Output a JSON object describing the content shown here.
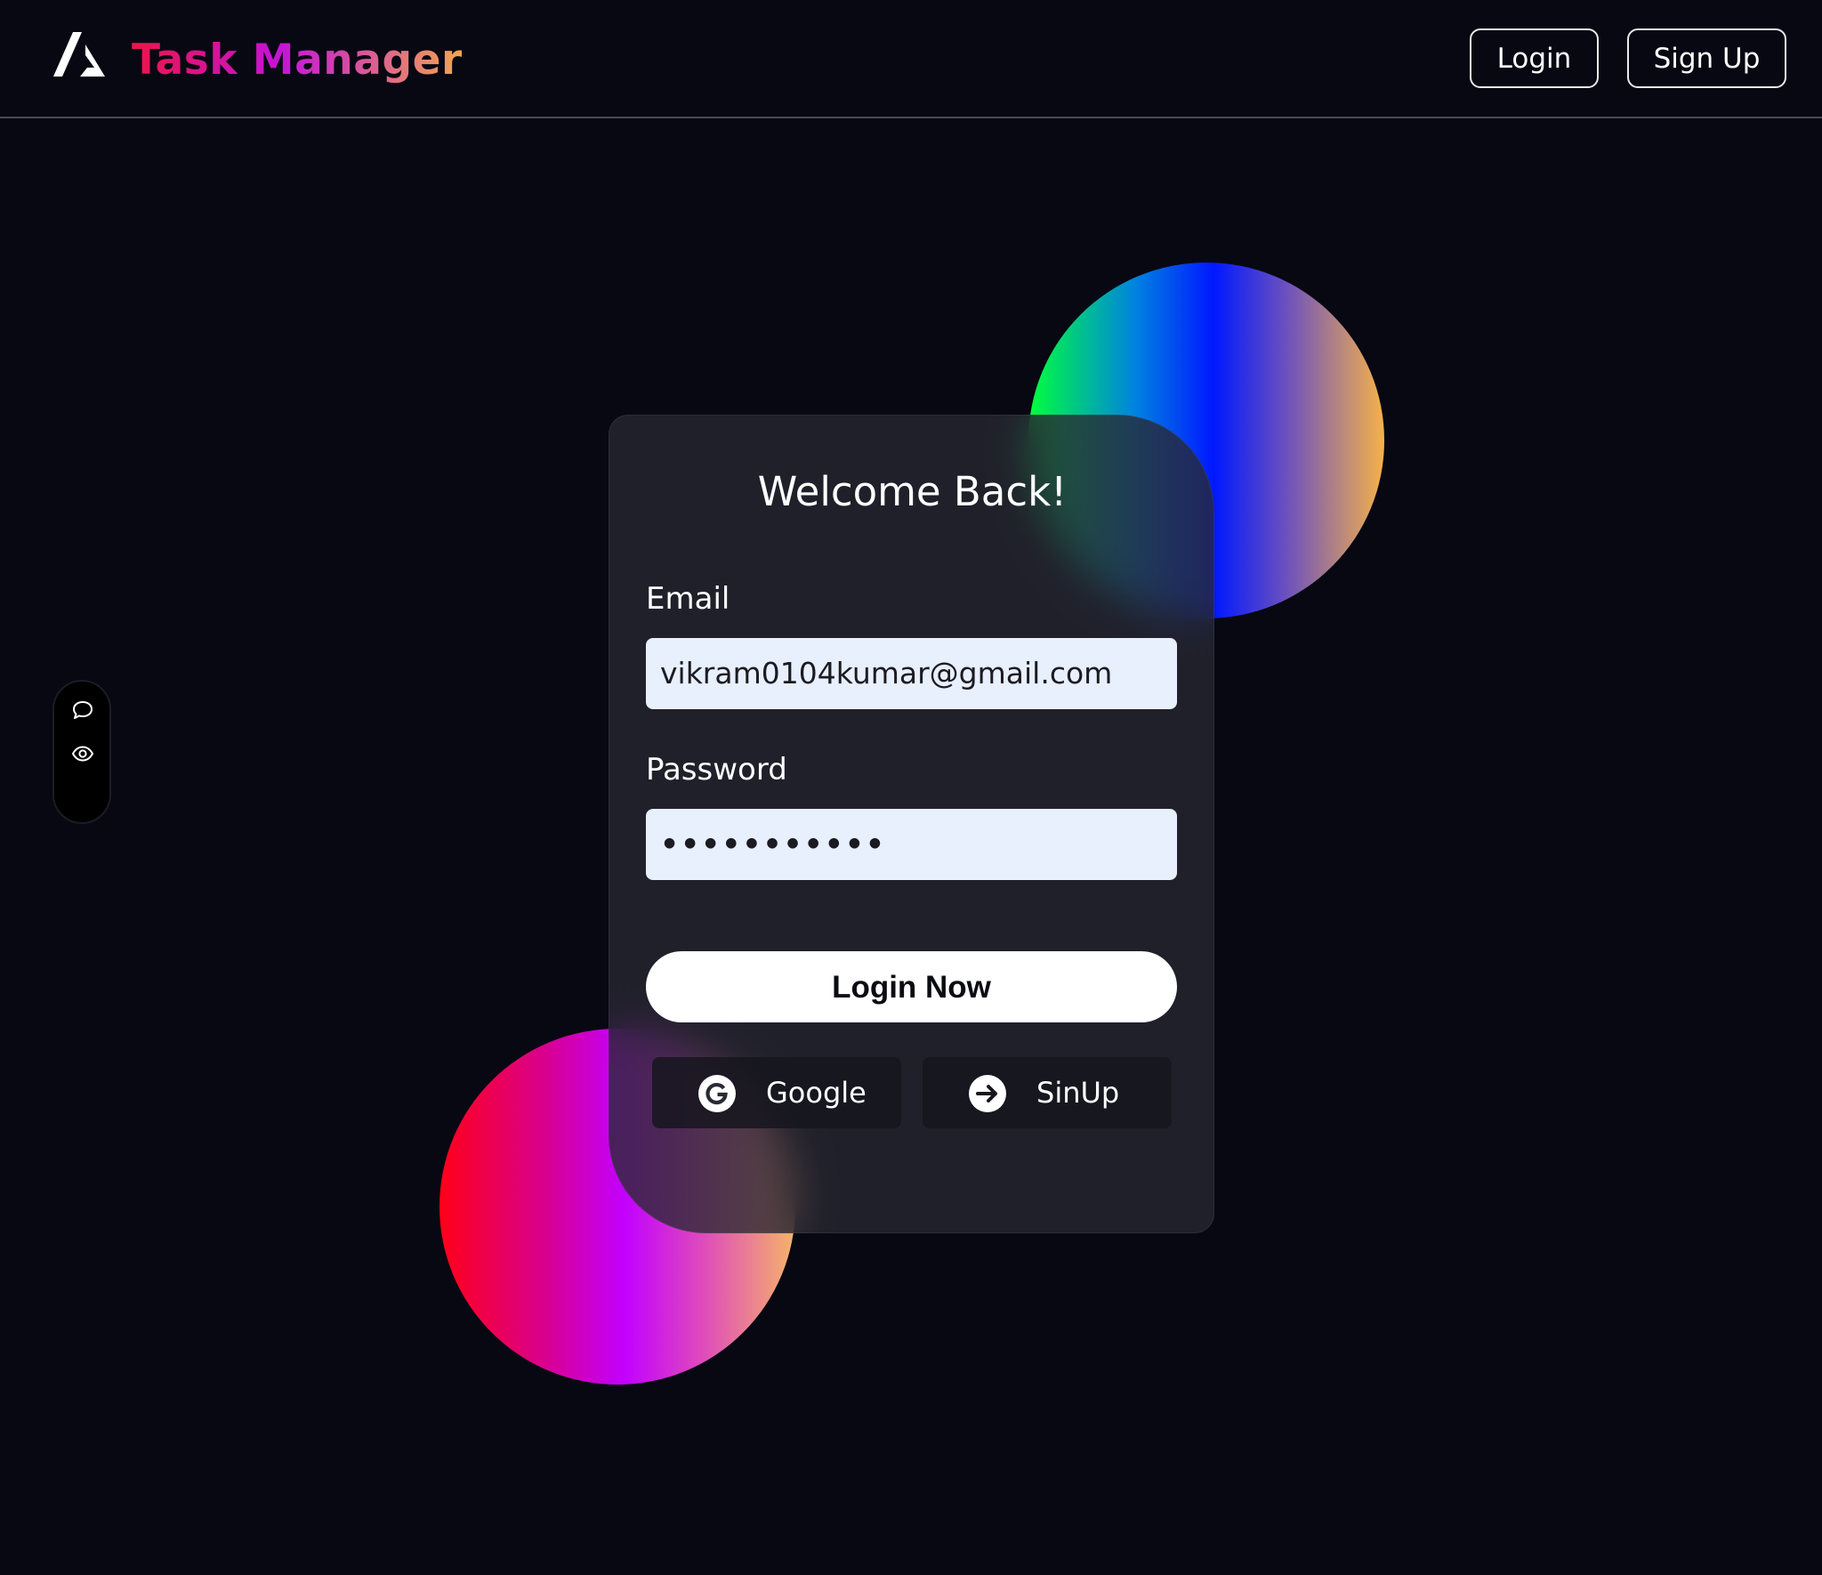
{
  "header": {
    "brand": "Task Manager",
    "nav": {
      "login_label": "Login",
      "signup_label": "Sign Up"
    }
  },
  "side_toolbar": {
    "icons": [
      "chat-bubble-icon",
      "eye-icon"
    ]
  },
  "login_card": {
    "title": "Welcome Back!",
    "email_label": "Email",
    "email_value": "vikram0104kumar@gmail.com",
    "password_label": "Password",
    "password_value": "•••••••••••",
    "submit_label": "Login Now",
    "google_label": "Google",
    "signup_label": "SinUp"
  },
  "colors": {
    "background": "#080813",
    "brand_gradient": [
      "#ec1547",
      "#c414d9",
      "#f2a64e"
    ],
    "input_bg": "#e8effd",
    "card_bg": "#282832"
  }
}
